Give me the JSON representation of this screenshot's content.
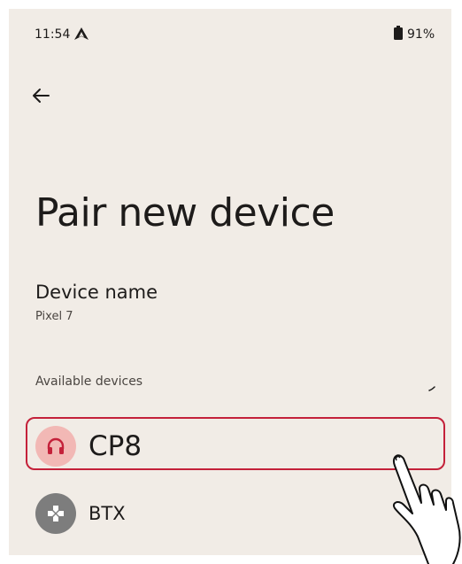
{
  "status_bar": {
    "time": "11:54",
    "battery": "91%",
    "nav_icon": "navigation-arrow-icon",
    "battery_icon": "battery-icon"
  },
  "header": {
    "back_icon": "arrow-left-icon"
  },
  "page": {
    "title": "Pair new device"
  },
  "device_name": {
    "label": "Device name",
    "value": "Pixel 7"
  },
  "available_devices": {
    "header": "Available devices",
    "items": [
      {
        "label": "CP8",
        "icon": "headphones-icon",
        "highlighted": true,
        "avatar_color": "#f2b8b5",
        "icon_color": "#c4213a"
      },
      {
        "label": "BTX",
        "icon": "gamepad-icon",
        "highlighted": false,
        "avatar_color": "#7d7d7d",
        "icon_color": "#ffffff"
      }
    ]
  },
  "annotation": {
    "highlight_color": "#c4213a",
    "cursor_icon": "hand-pointer-icon"
  },
  "colors": {
    "background": "#f1ece6",
    "text": "#1d1b1a"
  }
}
